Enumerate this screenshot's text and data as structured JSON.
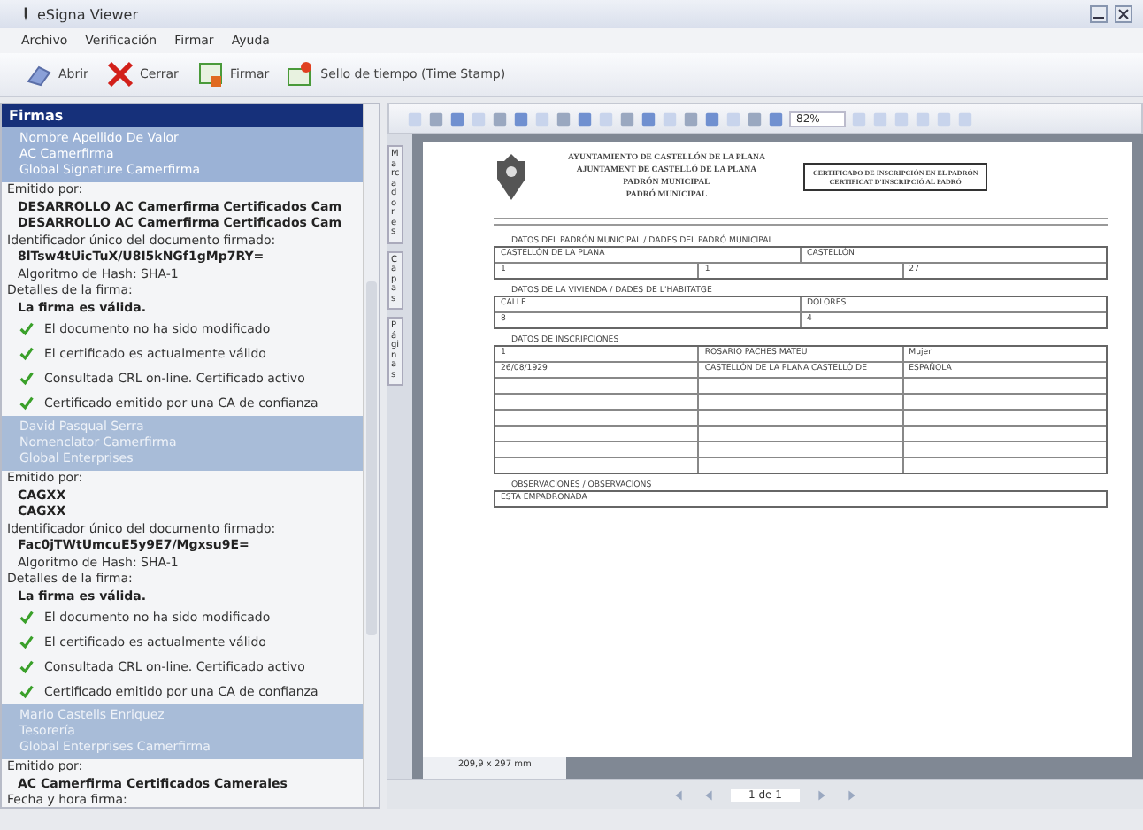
{
  "window": {
    "title": "eSigna Viewer"
  },
  "menu": [
    "Archivo",
    "Verificación",
    "Firmar",
    "Ayuda"
  ],
  "toolbar": [
    {
      "kind": "open",
      "label": "Abrir"
    },
    {
      "kind": "close",
      "label": "Cerrar"
    },
    {
      "kind": "sign",
      "label": "Firmar"
    },
    {
      "kind": "stamp",
      "label": "Sello de tiempo (Time Stamp)"
    }
  ],
  "signatures_panel": {
    "title": "Firmas",
    "signatures": [
      {
        "signer": [
          "Nombre Apellido De Valor",
          "AC Camerfirma",
          "Global Signature Camerfirma"
        ],
        "selected": true,
        "issuer_label": "Emitido por:",
        "issuer": [
          "DESARROLLO AC Camerfirma Certificados Cam",
          "DESARROLLO AC Camerfirma Certificados Cam"
        ],
        "id_label": "Identificador único del documento firmado:",
        "id": "8lTsw4tUicTuX/U8I5kNGf1gMp7RY=",
        "hash": "Algoritmo de Hash: SHA-1",
        "details_label": "Detalles de la firma:",
        "status": "La firma es válida.",
        "checks": [
          {
            "text": "El documento no ha sido modificado",
            "ok": true
          },
          {
            "text": "El certificado es actualmente válido",
            "ok": true
          },
          {
            "text": "Consultada CRL on-line. Certificado activo",
            "ok": true
          },
          {
            "text": "Certificado emitido por una CA de confianza",
            "ok": true
          }
        ]
      },
      {
        "signer": [
          "David Pasqual Serra",
          "Nomenclator Camerfirma",
          "Global Enterprises"
        ],
        "selected": false,
        "issuer_label": "Emitido por:",
        "issuer": [
          "CAGXX",
          "CAGXX"
        ],
        "id_label": "Identificador único del documento firmado:",
        "id": "Fac0jTWtUmcuE5y9E7/Mgxsu9E=",
        "hash": "Algoritmo de Hash: SHA-1",
        "details_label": "Detalles de la firma:",
        "status": "La firma es válida.",
        "checks": [
          {
            "text": "El documento no ha sido modificado",
            "ok": true
          },
          {
            "text": "El certificado es actualmente válido",
            "ok": true
          },
          {
            "text": "Consultada CRL on-line. Certificado activo",
            "ok": true
          },
          {
            "text": "Certificado emitido por una CA de confianza",
            "ok": true
          }
        ]
      },
      {
        "signer": [
          "Mario Castells Enriquez",
          "Tesorería",
          "Global Enterprises Camerfirma"
        ],
        "selected": false,
        "issuer_label": "Emitido por:",
        "issuer": [
          "AC Camerfirma Certificados Camerales"
        ],
        "id_label": "Fecha y hora firma:"
      }
    ]
  },
  "side_tabs": [
    "Marcadores",
    "Capas",
    "Páginas"
  ],
  "viewer": {
    "zoom": "82%",
    "page_size": "209,9 x 297 mm",
    "page": "1 de 1"
  },
  "document": {
    "header": [
      "AYUNTAMIENTO DE CASTELLÓN DE LA PLANA",
      "AJUNTAMENT DE CASTELLÓ DE LA PLANA",
      "PADRÓN MUNICIPAL",
      "PADRÓ MUNICIPAL"
    ],
    "certificate": [
      "CERTIFICADO DE INSCRIPCIÓN EN EL PADRÓN",
      "CERTIFICAT D'INSCRIPCIÓ AL PADRÓ"
    ],
    "sections": [
      {
        "title": "DATOS DEL PADRÓN MUNICIPAL / DADES DEL PADRÓ MUNICIPAL",
        "rows": [
          {
            "kind": "data",
            "cells": [
              "CASTELLÓN DE LA PLANA",
              "CASTELLÓN"
            ]
          },
          {
            "kind": "data",
            "cells": [
              "1",
              "1",
              "27"
            ]
          }
        ]
      },
      {
        "title": "DATOS DE LA VIVIENDA / DADES DE L'HABITATGE",
        "rows": [
          {
            "kind": "data",
            "cells": [
              "CALLE",
              "DOLORES"
            ]
          },
          {
            "kind": "data",
            "cells": [
              "8",
              "4"
            ]
          }
        ]
      },
      {
        "title": "DATOS DE INSCRIPCIONES",
        "rows": [
          {
            "kind": "data",
            "cells": [
              "1",
              "ROSARIO PACHES MATEU",
              "Mujer"
            ]
          },
          {
            "kind": "data",
            "cells": [
              "26/08/1929",
              "CASTELLÓN DE LA PLANA CASTELLÓ DE",
              "ESPAÑOLA"
            ]
          },
          {
            "kind": "blank"
          },
          {
            "kind": "blank"
          },
          {
            "kind": "blank"
          },
          {
            "kind": "blank"
          },
          {
            "kind": "blank"
          },
          {
            "kind": "blank"
          }
        ]
      },
      {
        "title": "OBSERVACIONES / OBSERVACIONS",
        "rows": [
          {
            "kind": "data",
            "cells": [
              "ESTA EMPADRONADA"
            ]
          }
        ]
      }
    ]
  }
}
